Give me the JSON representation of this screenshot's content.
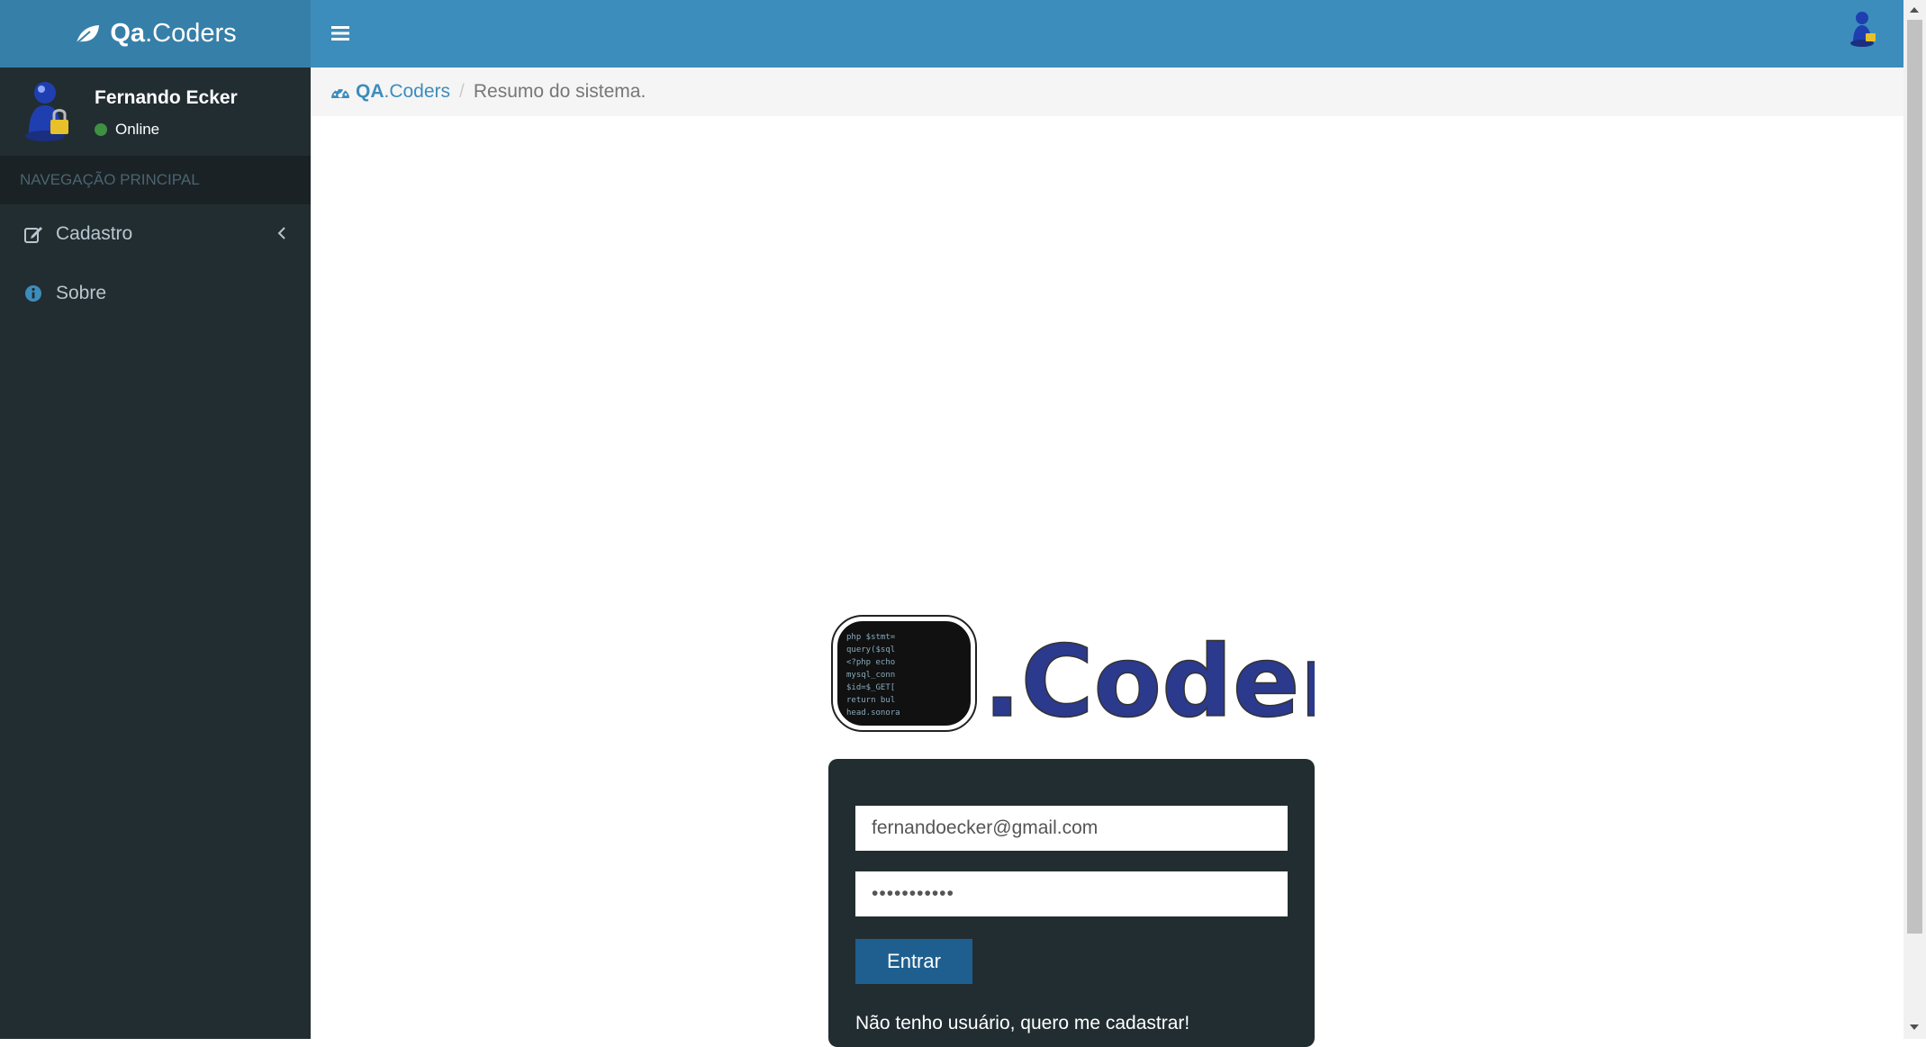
{
  "brand": {
    "bold": "Qa",
    "rest": ".Coders"
  },
  "user": {
    "name": "Fernando Ecker",
    "status": "Online"
  },
  "sidebar": {
    "header": "NAVEGAÇÃO PRINCIPAL",
    "items": [
      {
        "label": "Cadastro",
        "icon": "edit-icon"
      },
      {
        "label": "Sobre",
        "icon": "info-icon"
      }
    ]
  },
  "breadcrumb": {
    "home_bold": "QA",
    "home_rest": ".Coders",
    "separator": "/",
    "current": "Resumo do sistema."
  },
  "login": {
    "email": "fernandoecker@gmail.com",
    "password": "•••••••••••",
    "button": "Entrar",
    "register": "Não tenho usuário, quero me cadastrar!"
  },
  "logo_image": {
    "text": "Qa.Coders"
  },
  "colors": {
    "header_blue": "#3c8dbc",
    "logo_blue": "#367fa9",
    "sidebar_dark": "#222d32",
    "button_blue": "#1e5f8f"
  }
}
